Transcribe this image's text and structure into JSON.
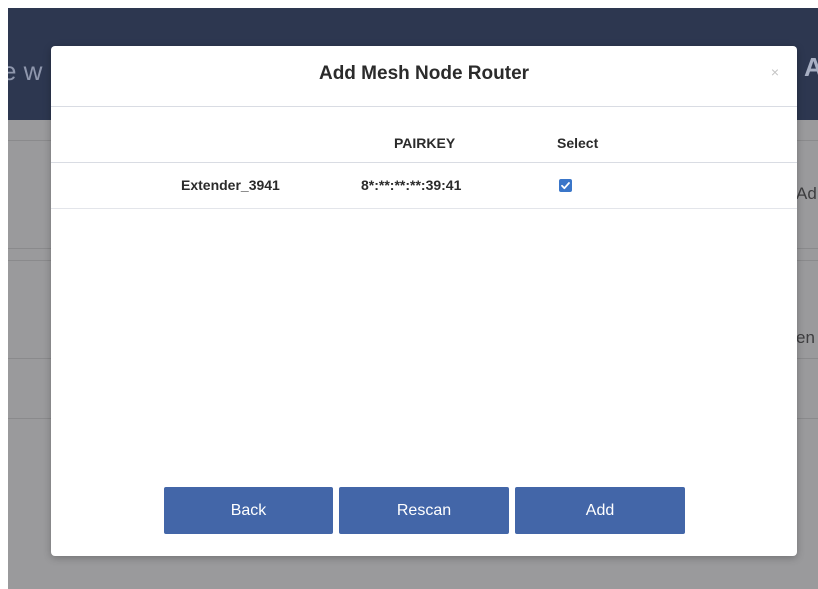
{
  "background": {
    "header_left_text": "e w",
    "header_right_text": "A",
    "side_text_1": "Ad",
    "side_text_2": "en"
  },
  "modal": {
    "title": "Add Mesh Node Router",
    "close_label": "×",
    "table": {
      "columns": [
        "",
        "PAIRKEY",
        "Select"
      ],
      "rows": [
        {
          "name": "Extender_3941",
          "pairkey": "8*:**:**:**:39:41",
          "selected": true
        }
      ]
    },
    "buttons": {
      "back": "Back",
      "rescan": "Rescan",
      "add": "Add"
    }
  },
  "colors": {
    "header_bg": "#2d3750",
    "button_bg": "#4366a8",
    "checkbox_bg": "#3a76c9",
    "overlay_bg": "#9a9a9c"
  }
}
